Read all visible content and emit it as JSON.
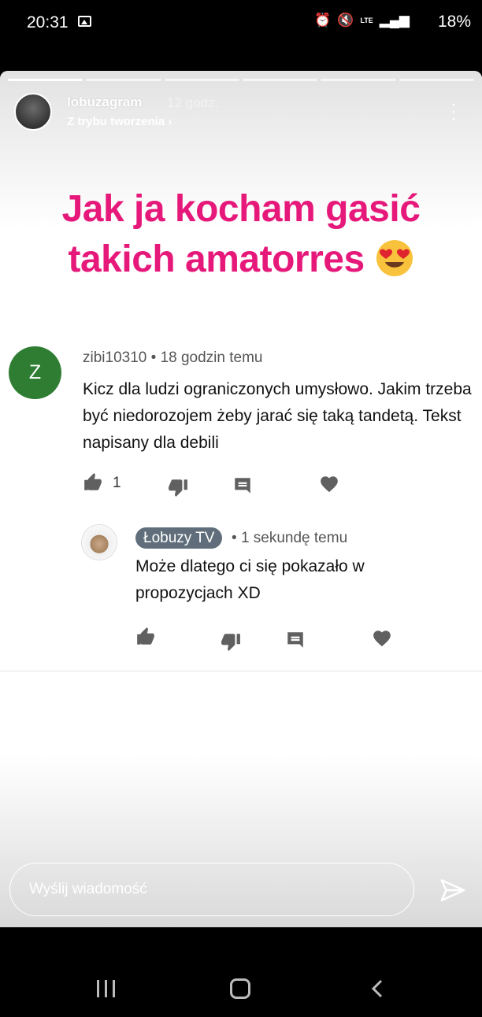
{
  "status_bar": {
    "time": "20:31",
    "icons": [
      "gallery-icon",
      "alarm-icon",
      "mute-icon",
      "lte-signal-icon",
      "battery-icon"
    ],
    "lte": "LTE",
    "battery": "18%"
  },
  "story": {
    "progress_segments": 6,
    "progress_done": 1,
    "username": "lobuzagram",
    "time_ago": "12 godz.",
    "subtitle": "Z trybu tworzenia",
    "headline_line1": "Jak ja kocham gasić",
    "headline_line2": "takich amatorres",
    "headline_color": "#e6197b"
  },
  "comment": {
    "avatar_letter": "Z",
    "avatar_color": "#2e7d32",
    "author": "zibi10310",
    "time_ago": "18 godzin temu",
    "text": "Kicz dla ludzi ograniczonych umysłowo. Jakim trzeba być niedorozojem żeby jarać się taką tandetą. Tekst napisany dla debili",
    "like_count": "1"
  },
  "reply": {
    "author": "Łobuzy TV",
    "time_ago": "1 sekundę temu",
    "text": "Może dlatego ci się pokazało w propozycjach XD"
  },
  "message": {
    "placeholder": "Wyślij wiadomość"
  }
}
